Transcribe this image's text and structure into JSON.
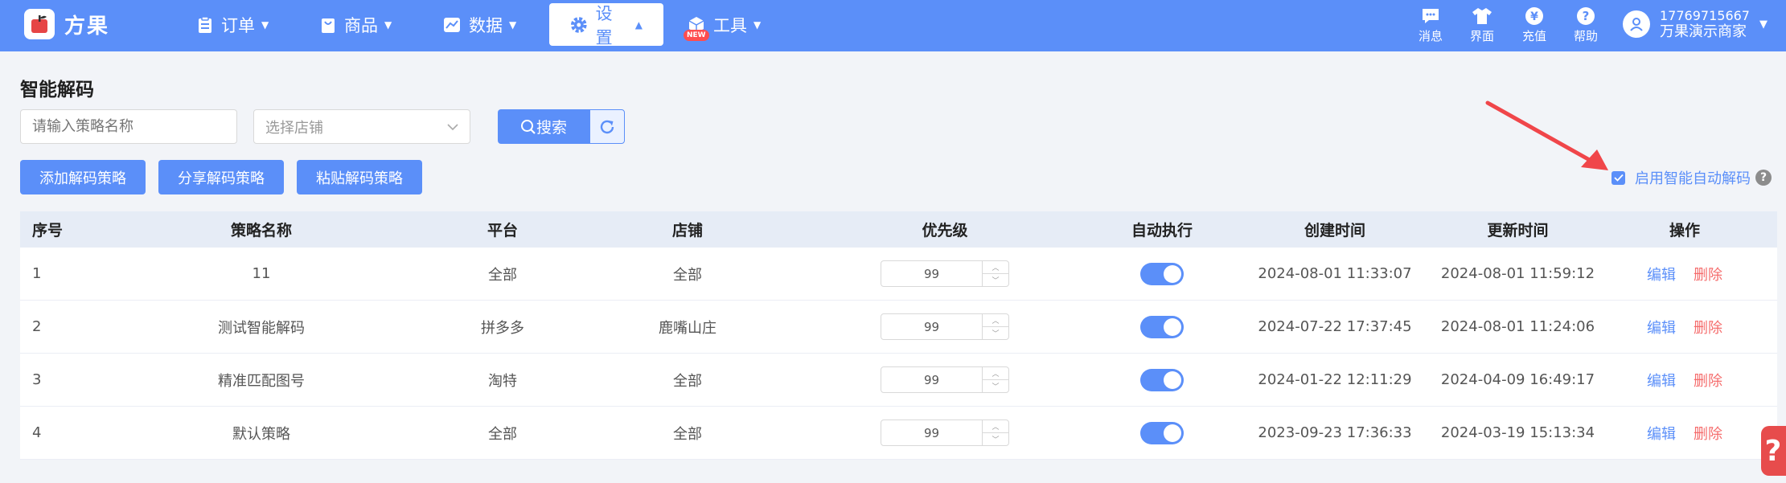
{
  "app": {
    "name": "方果"
  },
  "nav": {
    "items": [
      {
        "label": "订单"
      },
      {
        "label": "商品"
      },
      {
        "label": "数据"
      },
      {
        "label": "设置"
      },
      {
        "label": "工具"
      }
    ],
    "active_index": 3,
    "tools_badge": "NEW"
  },
  "top_right": {
    "tools": [
      {
        "label": "消息",
        "icon": "message-icon"
      },
      {
        "label": "界面",
        "icon": "shirt-icon"
      },
      {
        "label": "充值",
        "icon": "yen-icon"
      },
      {
        "label": "帮助",
        "icon": "help-icon"
      }
    ],
    "user": {
      "phone": "17769715667",
      "name": "万果演示商家"
    }
  },
  "page": {
    "title": "智能解码",
    "search_placeholder": "请输入策略名称",
    "shop_placeholder": "选择店铺",
    "search_label": "搜索",
    "actions": [
      "添加解码策略",
      "分享解码策略",
      "粘贴解码策略"
    ],
    "auto_decode_label": "启用智能自动解码",
    "auto_decode_checked": true
  },
  "table": {
    "headers": [
      "序号",
      "策略名称",
      "平台",
      "店铺",
      "优先级",
      "自动执行",
      "创建时间",
      "更新时间",
      "操作"
    ],
    "edit_label": "编辑",
    "delete_label": "删除",
    "rows": [
      {
        "idx": "1",
        "name": "11",
        "platform": "全部",
        "shop": "全部",
        "priority": "99",
        "auto": true,
        "created": "2024-08-01 11:33:07",
        "updated": "2024-08-01 11:59:12"
      },
      {
        "idx": "2",
        "name": "测试智能解码",
        "platform": "拼多多",
        "shop": "鹿嘴山庄",
        "priority": "99",
        "auto": true,
        "created": "2024-07-22 17:37:45",
        "updated": "2024-08-01 11:24:06"
      },
      {
        "idx": "3",
        "name": "精准匹配图号",
        "platform": "淘特",
        "shop": "全部",
        "priority": "99",
        "auto": true,
        "created": "2024-01-22 12:11:29",
        "updated": "2024-04-09 16:49:17"
      },
      {
        "idx": "4",
        "name": "默认策略",
        "platform": "全部",
        "shop": "全部",
        "priority": "99",
        "auto": true,
        "created": "2023-09-23 17:36:33",
        "updated": "2024-03-19 15:13:34"
      }
    ]
  },
  "float_help": "?",
  "colors": {
    "primary": "#5b8ff9",
    "danger": "#f56c6c"
  }
}
